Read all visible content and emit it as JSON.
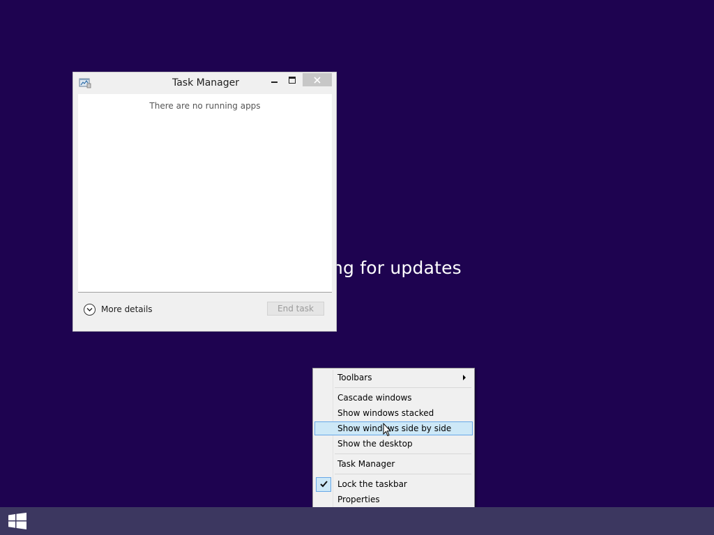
{
  "background": {
    "color": "#1e0350",
    "status_text": "ng for updates"
  },
  "task_manager": {
    "title": "Task Manager",
    "empty_message": "There are no running apps",
    "more_details_label": "More details",
    "end_task_label": "End task",
    "icons": {
      "app": "task-manager-icon",
      "minimize": "minimize-icon",
      "maximize": "maximize-icon",
      "close": "close-icon",
      "expand": "chevron-down-icon"
    }
  },
  "context_menu": {
    "items": {
      "toolbars": "Toolbars",
      "cascade": "Cascade windows",
      "stacked": "Show windows stacked",
      "side_by_side": "Show windows side by side",
      "desktop": "Show the desktop",
      "task_manager": "Task Manager",
      "lock_taskbar": "Lock the taskbar",
      "properties": "Properties"
    },
    "highlighted_item": "side_by_side",
    "lock_taskbar_checked": true,
    "highlight_color": "#cde8f7",
    "highlight_border": "#66a7e8"
  },
  "taskbar": {
    "color": "#3c3760",
    "start_icon": "windows-logo-icon"
  }
}
